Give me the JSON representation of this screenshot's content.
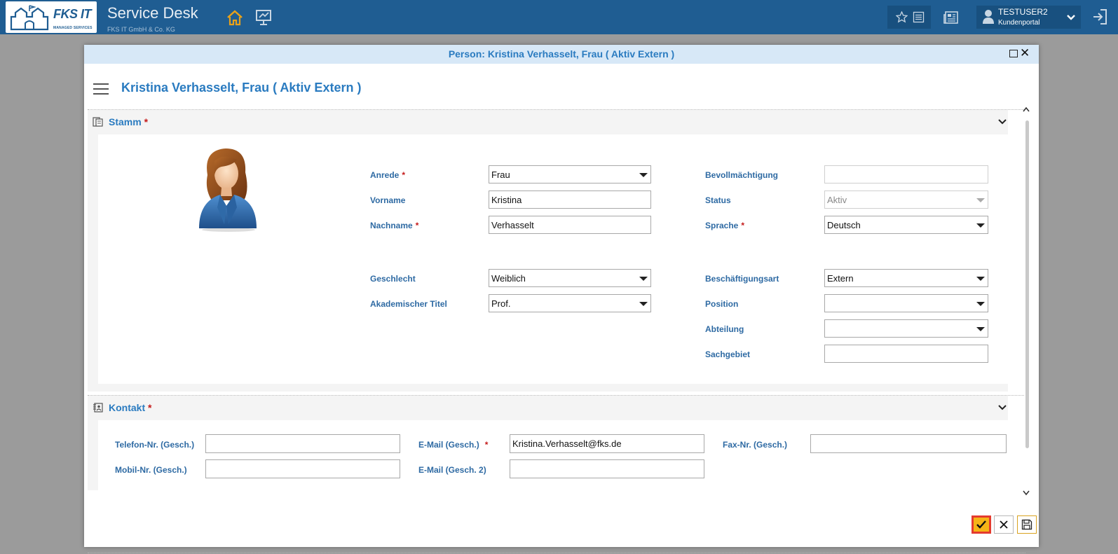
{
  "topbar": {
    "logo_name": "FKS IT",
    "logo_tagline": "MANAGED SERVICES",
    "app_title": "Service Desk",
    "company": "FKS IT GmbH & Co. KG",
    "user_name": "TESTUSER2",
    "user_role": "Kundenportal",
    "icons": [
      "home-icon",
      "monitor-icon",
      "star-icon",
      "list-icon",
      "news-icon",
      "user-icon",
      "chevron-down-icon",
      "logout-icon"
    ]
  },
  "dialog": {
    "title": "Person: Kristina Verhasselt, Frau ( Aktiv Extern )",
    "header": "Kristina Verhasselt, Frau ( Aktiv Extern )"
  },
  "stamm": {
    "title": "Stamm",
    "required_mark": "*",
    "fields": {
      "anrede": {
        "label": "Anrede",
        "value": "Frau"
      },
      "vorname": {
        "label": "Vorname",
        "value": "Kristina"
      },
      "nachname": {
        "label": "Nachname",
        "value": "Verhasselt"
      },
      "geschlecht": {
        "label": "Geschlecht",
        "value": "Weiblich"
      },
      "titel": {
        "label": "Akademischer Titel",
        "value": "Prof."
      },
      "bevollmaechtigung": {
        "label": "Bevollmächtigung",
        "value": ""
      },
      "status": {
        "label": "Status",
        "value": "Aktiv"
      },
      "sprache": {
        "label": "Sprache",
        "value": "Deutsch"
      },
      "beschaeftigungsart": {
        "label": "Beschäftigungsart",
        "value": "Extern"
      },
      "position": {
        "label": "Position",
        "value": ""
      },
      "abteilung": {
        "label": "Abteilung",
        "value": ""
      },
      "sachgebiet": {
        "label": "Sachgebiet",
        "value": ""
      }
    }
  },
  "kontakt": {
    "title": "Kontakt",
    "required_mark": "*",
    "fields": {
      "telefon": {
        "label": "Telefon-Nr. (Gesch.)",
        "value": ""
      },
      "mobil": {
        "label": "Mobil-Nr. (Gesch.)",
        "value": ""
      },
      "email": {
        "label": "E-Mail (Gesch.)",
        "value": "Kristina.Verhasselt@fks.de"
      },
      "email2": {
        "label": "E-Mail (Gesch. 2)",
        "value": ""
      },
      "fax": {
        "label": "Fax-Nr. (Gesch.)",
        "value": ""
      }
    }
  },
  "colors": {
    "topbar": "#1f5d92",
    "accent": "#2a7bc0",
    "label": "#2e6aa3",
    "required": "#c41a1a",
    "ok_button": "#f5b417",
    "ok_border": "#e43b2f"
  }
}
